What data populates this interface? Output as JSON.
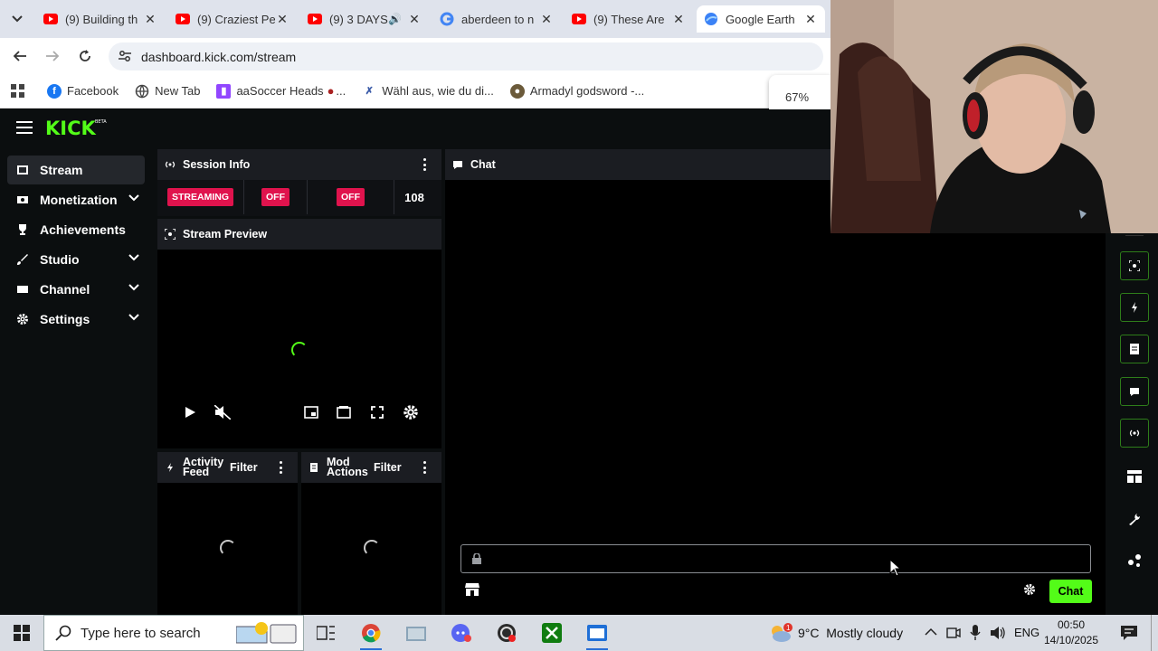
{
  "browser": {
    "tabs": [
      {
        "title": "(9) Building th",
        "favicon": "youtube-icon",
        "active": false
      },
      {
        "title": "(9) Craziest Pe",
        "favicon": "youtube-icon",
        "active": false
      },
      {
        "title": "(9) 3 DAYS",
        "favicon": "youtube-icon",
        "active": false,
        "audio": true
      },
      {
        "title": "aberdeen to n",
        "favicon": "google-icon",
        "active": false
      },
      {
        "title": "(9) These Are",
        "favicon": "youtube-icon",
        "active": false
      },
      {
        "title": "Google Earth",
        "favicon": "google-earth-icon",
        "active": true
      }
    ],
    "url": "dashboard.kick.com/stream",
    "bookmarks": [
      {
        "label": "Facebook",
        "icon": "facebook-icon"
      },
      {
        "label": "New Tab",
        "icon": "globe-icon"
      },
      {
        "label": "aaSoccer Heads",
        "icon": "twitch-icon"
      },
      {
        "label": "Wähl aus, wie du di...",
        "icon": "bookmark-site-icon"
      },
      {
        "label": "Armadyl godsword -...",
        "icon": "runescape-icon"
      }
    ],
    "zoom": "67%"
  },
  "kick": {
    "logo": "KICK",
    "logo_beta": "BETA",
    "sidebar": [
      {
        "label": "Stream",
        "icon": "broadcast-icon",
        "active": true,
        "expandable": false
      },
      {
        "label": "Monetization",
        "icon": "money-icon",
        "active": false,
        "expandable": true
      },
      {
        "label": "Achievements",
        "icon": "trophy-icon",
        "active": false,
        "expandable": false
      },
      {
        "label": "Studio",
        "icon": "brush-icon",
        "active": false,
        "expandable": true
      },
      {
        "label": "Channel",
        "icon": "channel-icon",
        "active": false,
        "expandable": true
      },
      {
        "label": "Settings",
        "icon": "gear-icon",
        "active": false,
        "expandable": true
      }
    ],
    "session_info": {
      "title": "Session Info",
      "status": [
        "STREAMING",
        "OFF",
        "OFF"
      ],
      "viewers": "108"
    },
    "stream_preview": {
      "title": "Stream Preview"
    },
    "activity_feed": {
      "title_line1": "Activity",
      "title_line2": "Feed",
      "filter": "Filter"
    },
    "mod_actions": {
      "title_line1": "Mod",
      "title_line2": "Actions",
      "filter": "Filter"
    },
    "chat": {
      "title": "Chat",
      "send_label": "Chat",
      "input_value": ""
    },
    "accent": "#53fc18",
    "live_color": "#e0134d"
  },
  "taskbar": {
    "search_placeholder": "Type here to search",
    "weather": "9°C  Mostly cloudy",
    "weather_badge": "1",
    "language": "ENG",
    "time": "00:50",
    "date": "14/10/2025"
  }
}
